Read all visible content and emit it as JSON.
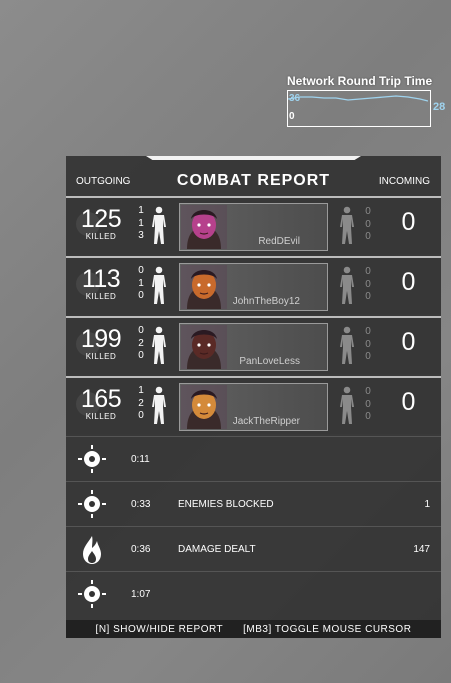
{
  "network": {
    "title": "Network Round Trip Time",
    "max": "36",
    "min": "0",
    "current": "28"
  },
  "header": {
    "outgoing": "OUTGOING",
    "title": "COMBAT REPORT",
    "incoming": "INCOMING"
  },
  "rows": [
    {
      "kills": "125",
      "killed_label": "KILLED",
      "out_hits": [
        "1",
        "1",
        "3"
      ],
      "name": "RedDEvil",
      "in_hits": [
        "0",
        "0",
        "0"
      ],
      "in_kills": "0",
      "avatar_color": "#b6418c"
    },
    {
      "kills": "113",
      "killed_label": "KILLED",
      "out_hits": [
        "0",
        "1",
        "0"
      ],
      "name": "JohnTheBoy12",
      "in_hits": [
        "0",
        "0",
        "0"
      ],
      "in_kills": "0",
      "avatar_color": "#c86a2c"
    },
    {
      "kills": "199",
      "killed_label": "KILLED",
      "out_hits": [
        "0",
        "2",
        "0"
      ],
      "name": "PanLoveLess",
      "in_hits": [
        "0",
        "0",
        "0"
      ],
      "in_kills": "0",
      "avatar_color": "#5a2a26"
    },
    {
      "kills": "165",
      "killed_label": "KILLED",
      "out_hits": [
        "1",
        "2",
        "0"
      ],
      "name": "JackTheRipper",
      "in_hits": [
        "0",
        "0",
        "0"
      ],
      "in_kills": "0",
      "avatar_color": "#d48a3a"
    }
  ],
  "events": [
    {
      "icon": "target-icon",
      "time": "0:11",
      "label": "",
      "value": ""
    },
    {
      "icon": "target-icon",
      "time": "0:33",
      "label": "ENEMIES BLOCKED",
      "value": "1"
    },
    {
      "icon": "flame-icon",
      "time": "0:36",
      "label": "DAMAGE DEALT",
      "value": "147"
    },
    {
      "icon": "target-icon",
      "time": "1:07",
      "label": "",
      "value": ""
    }
  ],
  "footer": {
    "toggle_report": "[N] SHOW/HIDE REPORT",
    "toggle_cursor": "[MB3] TOGGLE MOUSE CURSOR"
  }
}
